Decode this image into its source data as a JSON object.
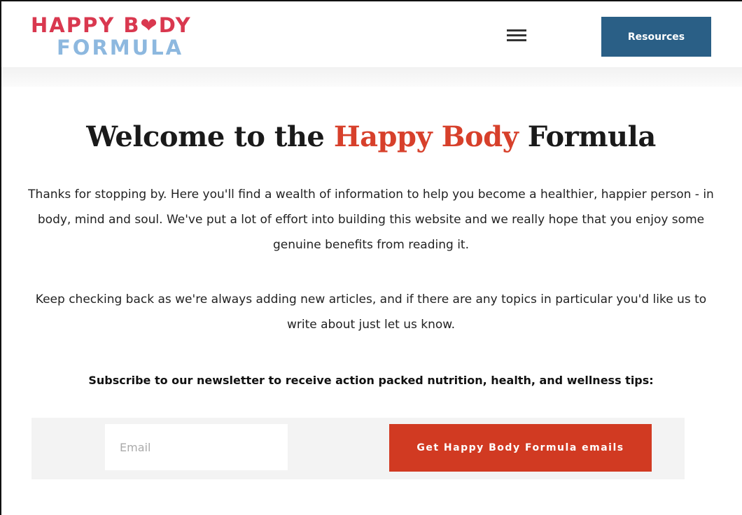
{
  "header": {
    "logo_line1": "HAPPY B❤DY",
    "logo_line2": "FORMULA",
    "menu_icon": "hamburger-menu-icon",
    "resources_label": "Resources"
  },
  "main": {
    "title_prefix": "Welcome to the ",
    "title_accent": "Happy Body",
    "title_suffix": " Formula",
    "intro_paragraph": "Thanks for stopping by. Here you'll find a wealth of information to help you become a healthier, happier person - in body, mind and soul. We've put a lot of effort into building this website and we really hope that you enjoy some genuine benefits from reading it.",
    "second_paragraph": "Keep checking back as we're always adding new articles, and if there are any topics in particular you'd like us to write about just let us know.",
    "subscribe_text": "Subscribe to our newsletter to receive action packed nutrition, health, and wellness tips:"
  },
  "form": {
    "email_placeholder": "Email",
    "email_value": "",
    "submit_label": "Get Happy Body Formula emails"
  },
  "colors": {
    "logo_red": "#d9384f",
    "logo_blue": "#8db8df",
    "resources_button": "#2a5f86",
    "accent": "#d7402b",
    "submit_button": "#d13a22"
  }
}
